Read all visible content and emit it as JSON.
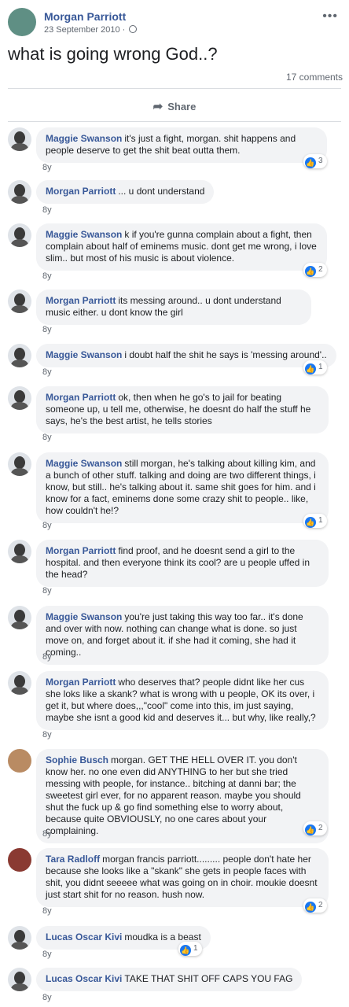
{
  "post": {
    "author": "Morgan Parriott",
    "date": "23 September 2010 ·",
    "text": "what is going wrong God..?",
    "comments_count": "17 comments",
    "share_label": "Share"
  },
  "icons": {
    "globe": "globe-icon",
    "share": "share-arrow-icon",
    "like": "thumbs-up-icon",
    "more": "more-options-icon"
  },
  "colors": {
    "name_link": "#385898",
    "like_blue": "#1877f2",
    "bubble": "#f2f3f5"
  },
  "comments": [
    {
      "name": "Maggie Swanson",
      "text": "it's just a fight, morgan. shit happens and people deserve to get the shit beat outta them.",
      "age": "8y",
      "likes": "3"
    },
    {
      "name": "Morgan Parriott",
      "text": "... u dont understand",
      "age": "8y",
      "likes": ""
    },
    {
      "name": "Maggie Swanson",
      "text": "k if you're gunna complain about a fight, then complain about half of eminems music. dont get me wrong, i love slim.. but most of his music is about violence.",
      "age": "8y",
      "likes": "2"
    },
    {
      "name": "Morgan Parriott",
      "text": "its messing around.. u dont understand music either. u dont know the girl",
      "age": "8y",
      "likes": ""
    },
    {
      "name": "Maggie Swanson",
      "text": "i doubt half the shit he says is 'messing around'..",
      "age": "8y",
      "likes": "1"
    },
    {
      "name": "Morgan Parriott",
      "text": "ok, then when he go's to jail for beating someone up, u tell me, otherwise, he doesnt do half the stuff he says, he's the best artist, he tells stories",
      "age": "8y",
      "likes": ""
    },
    {
      "name": "Maggie Swanson",
      "text": "still morgan, he's talking about killing kim, and a bunch of other stuff. talking and doing are two different things, i know, but still.. he's talking about it. same shit goes for him. and i know for a fact, eminems done some crazy shit to people.. like, how couldn't he!?",
      "age": "8y",
      "likes": "1"
    },
    {
      "name": "Morgan Parriott",
      "text": "find proof, and he doesnt send a girl to the hospital. and then everyone think its cool? are u people uffed in the head?",
      "age": "8y",
      "likes": ""
    },
    {
      "name": "Maggie Swanson",
      "text": "you're just taking this way too far.. it's done and over with now. nothing can change what is done. so just move on, and forget about it. if she had it coming, she had it coming..",
      "age": "8y",
      "likes": ""
    },
    {
      "name": "Morgan Parriott",
      "text": "who deserves that? people didnt like her cus she loks like a skank? what is wrong with u people, OK its over, i get it, but where does,,,\"cool\" come into this, im just saying, maybe she isnt a good kid and deserves it... but why, like really,?",
      "age": "8y",
      "likes": ""
    },
    {
      "name": "Sophie Busch",
      "text": "morgan. GET THE HELL OVER IT. you don't know her. no one even did ANYTHING to her but she tried messing with people, for instance.. bitching at danni bar; the sweetest girl ever, for no apparent reason. maybe you should shut the fuck up & go find something else to worry about, because quite OBVIOUSLY, no one cares about your complaining.",
      "age": "8y",
      "likes": "2"
    },
    {
      "name": "Tara Radloff",
      "text": "morgan francis parriott......... people don't hate her because she looks like a \"skank\" she gets in people faces with shit, you didnt seeeee what was going on in choir. moukie doesnt just start shit for no reason. hush now.",
      "age": "8y",
      "likes": "2"
    },
    {
      "name": "Lucas Oscar Kivi",
      "text": "moudka is a beast",
      "age": "8y",
      "likes": "1"
    },
    {
      "name": "Lucas Oscar Kivi",
      "text": "TAKE THAT SHIT OFF CAPS YOU FAG",
      "age": "8y",
      "likes": ""
    }
  ]
}
